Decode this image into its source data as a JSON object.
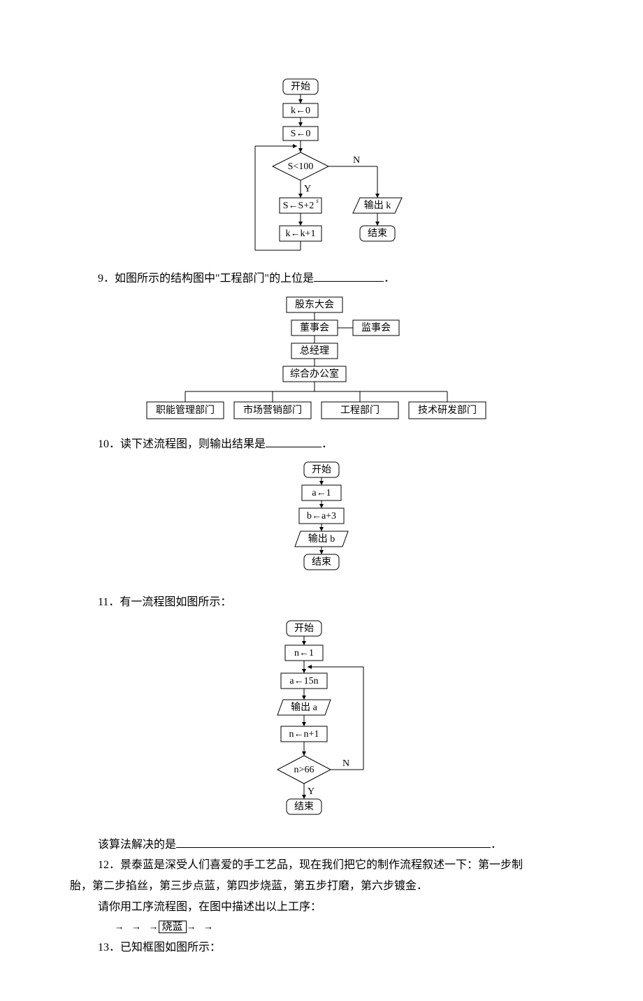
{
  "fc1": {
    "start": "开始",
    "k0": "k←0",
    "s0": "S←0",
    "cond": "S<100",
    "y": "Y",
    "n": "N",
    "sstep": "S←S+2",
    "sexp": "s",
    "kstep": "k←k+1",
    "out": "输出 k",
    "end": "结束"
  },
  "q9": {
    "text": "9．如图所示的结构图中\"工程部门\"的上位是",
    "boxes": {
      "a": "股东大会",
      "b": "董事会",
      "c": "监事会",
      "d": "总经理",
      "e": "综合办公室",
      "f": "职能管理部门",
      "g": "市场营销部门",
      "h": "工程部门",
      "i": "技术研发部门"
    }
  },
  "q10": {
    "text": "10．读下述流程图，则输出结果是",
    "fc": {
      "start": "开始",
      "a": "a←1",
      "b": "b←a+3",
      "out": "输出 b",
      "end": "结束"
    }
  },
  "q11": {
    "text": "11．有一流程图如图所示：",
    "fc": {
      "start": "开始",
      "n1": "n←1",
      "a15": "a←15n",
      "out": "输出 a",
      "ninc": "n←n+1",
      "cond": "n>66",
      "y": "Y",
      "n": "N",
      "end": "结束"
    },
    "tail": "该算法解决的是"
  },
  "q12": {
    "l1": "12．景泰蓝是深受人们喜爱的手工艺品，现在我们把它的制作流程叙述一下：第一步制",
    "l1c": "胎，第二步掐丝，第三步点蓝，第四步烧蓝，第五步打磨，第六步镀金．",
    "l2": "请你用工序流程图，在图中描述出以上工序：",
    "box": "烧蓝"
  },
  "q13": {
    "text": "13．已知框图如图所示："
  }
}
